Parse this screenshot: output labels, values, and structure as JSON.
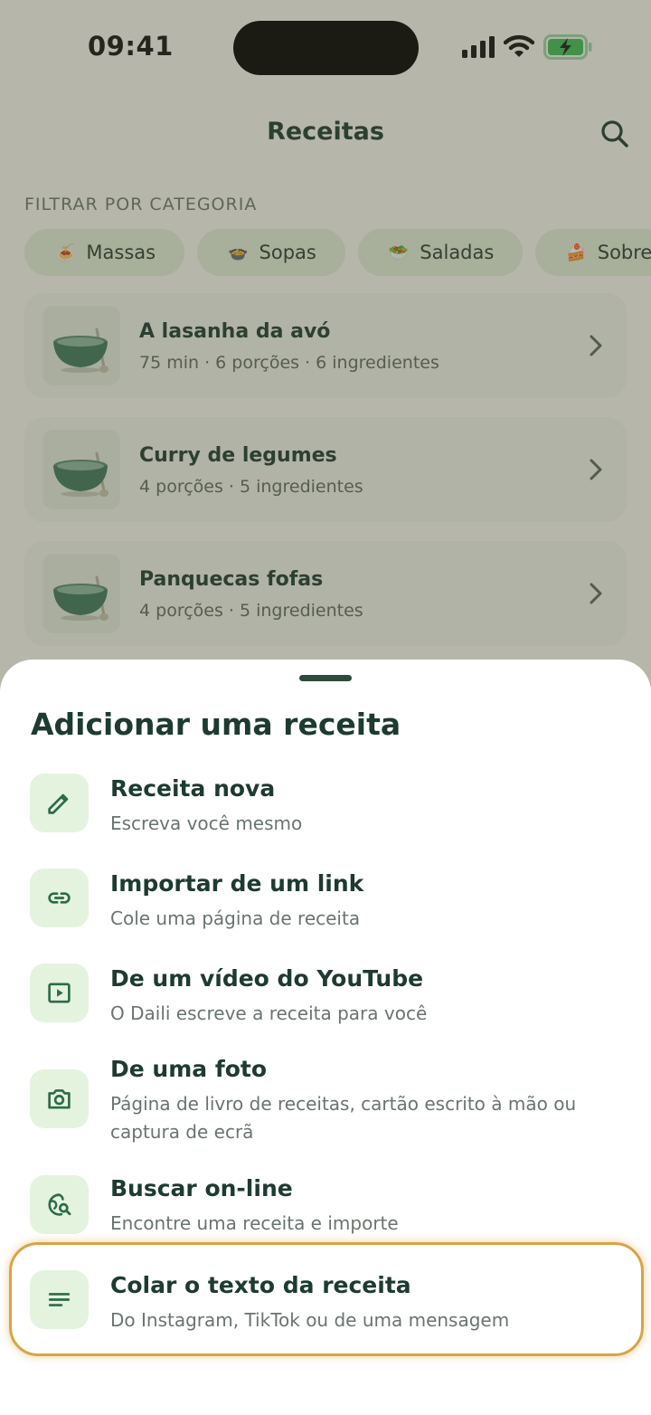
{
  "status": {
    "time": "09:41"
  },
  "nav": {
    "title": "Receitas"
  },
  "filter": {
    "label": "FILTRAR POR CATEGORIA",
    "chips": [
      {
        "emoji": "🍝",
        "label": "Massas"
      },
      {
        "emoji": "🍲",
        "label": "Sopas"
      },
      {
        "emoji": "🥗",
        "label": "Saladas"
      },
      {
        "emoji": "🍰",
        "label": "Sobremesas"
      }
    ]
  },
  "recipes": [
    {
      "title": "A lasanha da avó",
      "meta": "75 min · 6 porções · 6 ingredientes"
    },
    {
      "title": "Curry de legumes",
      "meta": "4 porções · 5 ingredientes"
    },
    {
      "title": "Panquecas fofas",
      "meta": "4 porções · 5 ingredientes"
    }
  ],
  "sheet": {
    "title": "Adicionar uma receita",
    "options": [
      {
        "icon": "pencil-icon",
        "title": "Receita nova",
        "subtitle": "Escreva você mesmo"
      },
      {
        "icon": "link-icon",
        "title": "Importar de um link",
        "subtitle": "Cole uma página de receita"
      },
      {
        "icon": "video-play-icon",
        "title": "De um vídeo do YouTube",
        "subtitle": "O Daili escreve a receita para você"
      },
      {
        "icon": "camera-icon",
        "title": "De uma foto",
        "subtitle": "Página de livro de receitas, cartão escrito à mão ou captura de ecrã"
      },
      {
        "icon": "globe-search-icon",
        "title": "Buscar on-line",
        "subtitle": "Encontre uma receita e importe"
      },
      {
        "icon": "text-lines-icon",
        "title": "Colar o texto da receita",
        "subtitle": "Do Instagram, TikTok ou de uma mensagem"
      }
    ]
  },
  "colors": {
    "accent_dark": "#1d3b30",
    "icon_bg": "#e4f3de",
    "icon_green": "#2c6b4a",
    "highlight": "#d9a443",
    "battery": "#3fbf57"
  }
}
